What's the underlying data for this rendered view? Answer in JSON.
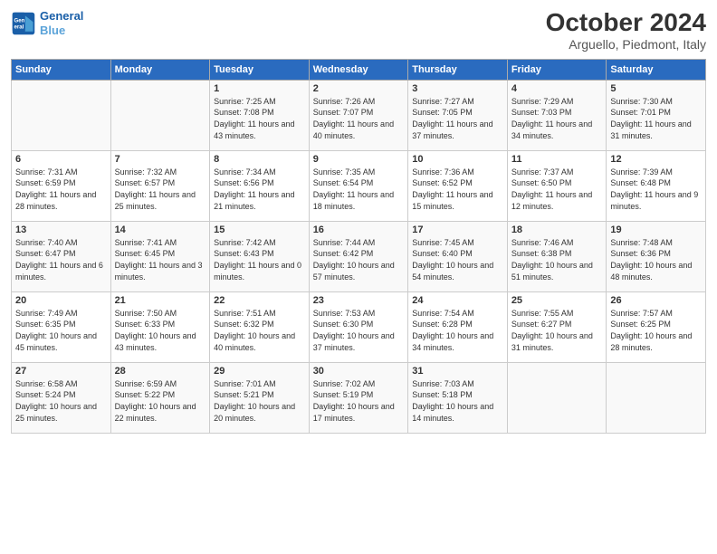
{
  "header": {
    "logo_line1": "General",
    "logo_line2": "Blue",
    "month": "October 2024",
    "location": "Arguello, Piedmont, Italy"
  },
  "days_of_week": [
    "Sunday",
    "Monday",
    "Tuesday",
    "Wednesday",
    "Thursday",
    "Friday",
    "Saturday"
  ],
  "weeks": [
    [
      {
        "day": "",
        "sunrise": "",
        "sunset": "",
        "daylight": ""
      },
      {
        "day": "",
        "sunrise": "",
        "sunset": "",
        "daylight": ""
      },
      {
        "day": "1",
        "sunrise": "Sunrise: 7:25 AM",
        "sunset": "Sunset: 7:08 PM",
        "daylight": "Daylight: 11 hours and 43 minutes."
      },
      {
        "day": "2",
        "sunrise": "Sunrise: 7:26 AM",
        "sunset": "Sunset: 7:07 PM",
        "daylight": "Daylight: 11 hours and 40 minutes."
      },
      {
        "day": "3",
        "sunrise": "Sunrise: 7:27 AM",
        "sunset": "Sunset: 7:05 PM",
        "daylight": "Daylight: 11 hours and 37 minutes."
      },
      {
        "day": "4",
        "sunrise": "Sunrise: 7:29 AM",
        "sunset": "Sunset: 7:03 PM",
        "daylight": "Daylight: 11 hours and 34 minutes."
      },
      {
        "day": "5",
        "sunrise": "Sunrise: 7:30 AM",
        "sunset": "Sunset: 7:01 PM",
        "daylight": "Daylight: 11 hours and 31 minutes."
      }
    ],
    [
      {
        "day": "6",
        "sunrise": "Sunrise: 7:31 AM",
        "sunset": "Sunset: 6:59 PM",
        "daylight": "Daylight: 11 hours and 28 minutes."
      },
      {
        "day": "7",
        "sunrise": "Sunrise: 7:32 AM",
        "sunset": "Sunset: 6:57 PM",
        "daylight": "Daylight: 11 hours and 25 minutes."
      },
      {
        "day": "8",
        "sunrise": "Sunrise: 7:34 AM",
        "sunset": "Sunset: 6:56 PM",
        "daylight": "Daylight: 11 hours and 21 minutes."
      },
      {
        "day": "9",
        "sunrise": "Sunrise: 7:35 AM",
        "sunset": "Sunset: 6:54 PM",
        "daylight": "Daylight: 11 hours and 18 minutes."
      },
      {
        "day": "10",
        "sunrise": "Sunrise: 7:36 AM",
        "sunset": "Sunset: 6:52 PM",
        "daylight": "Daylight: 11 hours and 15 minutes."
      },
      {
        "day": "11",
        "sunrise": "Sunrise: 7:37 AM",
        "sunset": "Sunset: 6:50 PM",
        "daylight": "Daylight: 11 hours and 12 minutes."
      },
      {
        "day": "12",
        "sunrise": "Sunrise: 7:39 AM",
        "sunset": "Sunset: 6:48 PM",
        "daylight": "Daylight: 11 hours and 9 minutes."
      }
    ],
    [
      {
        "day": "13",
        "sunrise": "Sunrise: 7:40 AM",
        "sunset": "Sunset: 6:47 PM",
        "daylight": "Daylight: 11 hours and 6 minutes."
      },
      {
        "day": "14",
        "sunrise": "Sunrise: 7:41 AM",
        "sunset": "Sunset: 6:45 PM",
        "daylight": "Daylight: 11 hours and 3 minutes."
      },
      {
        "day": "15",
        "sunrise": "Sunrise: 7:42 AM",
        "sunset": "Sunset: 6:43 PM",
        "daylight": "Daylight: 11 hours and 0 minutes."
      },
      {
        "day": "16",
        "sunrise": "Sunrise: 7:44 AM",
        "sunset": "Sunset: 6:42 PM",
        "daylight": "Daylight: 10 hours and 57 minutes."
      },
      {
        "day": "17",
        "sunrise": "Sunrise: 7:45 AM",
        "sunset": "Sunset: 6:40 PM",
        "daylight": "Daylight: 10 hours and 54 minutes."
      },
      {
        "day": "18",
        "sunrise": "Sunrise: 7:46 AM",
        "sunset": "Sunset: 6:38 PM",
        "daylight": "Daylight: 10 hours and 51 minutes."
      },
      {
        "day": "19",
        "sunrise": "Sunrise: 7:48 AM",
        "sunset": "Sunset: 6:36 PM",
        "daylight": "Daylight: 10 hours and 48 minutes."
      }
    ],
    [
      {
        "day": "20",
        "sunrise": "Sunrise: 7:49 AM",
        "sunset": "Sunset: 6:35 PM",
        "daylight": "Daylight: 10 hours and 45 minutes."
      },
      {
        "day": "21",
        "sunrise": "Sunrise: 7:50 AM",
        "sunset": "Sunset: 6:33 PM",
        "daylight": "Daylight: 10 hours and 43 minutes."
      },
      {
        "day": "22",
        "sunrise": "Sunrise: 7:51 AM",
        "sunset": "Sunset: 6:32 PM",
        "daylight": "Daylight: 10 hours and 40 minutes."
      },
      {
        "day": "23",
        "sunrise": "Sunrise: 7:53 AM",
        "sunset": "Sunset: 6:30 PM",
        "daylight": "Daylight: 10 hours and 37 minutes."
      },
      {
        "day": "24",
        "sunrise": "Sunrise: 7:54 AM",
        "sunset": "Sunset: 6:28 PM",
        "daylight": "Daylight: 10 hours and 34 minutes."
      },
      {
        "day": "25",
        "sunrise": "Sunrise: 7:55 AM",
        "sunset": "Sunset: 6:27 PM",
        "daylight": "Daylight: 10 hours and 31 minutes."
      },
      {
        "day": "26",
        "sunrise": "Sunrise: 7:57 AM",
        "sunset": "Sunset: 6:25 PM",
        "daylight": "Daylight: 10 hours and 28 minutes."
      }
    ],
    [
      {
        "day": "27",
        "sunrise": "Sunrise: 6:58 AM",
        "sunset": "Sunset: 5:24 PM",
        "daylight": "Daylight: 10 hours and 25 minutes."
      },
      {
        "day": "28",
        "sunrise": "Sunrise: 6:59 AM",
        "sunset": "Sunset: 5:22 PM",
        "daylight": "Daylight: 10 hours and 22 minutes."
      },
      {
        "day": "29",
        "sunrise": "Sunrise: 7:01 AM",
        "sunset": "Sunset: 5:21 PM",
        "daylight": "Daylight: 10 hours and 20 minutes."
      },
      {
        "day": "30",
        "sunrise": "Sunrise: 7:02 AM",
        "sunset": "Sunset: 5:19 PM",
        "daylight": "Daylight: 10 hours and 17 minutes."
      },
      {
        "day": "31",
        "sunrise": "Sunrise: 7:03 AM",
        "sunset": "Sunset: 5:18 PM",
        "daylight": "Daylight: 10 hours and 14 minutes."
      },
      {
        "day": "",
        "sunrise": "",
        "sunset": "",
        "daylight": ""
      },
      {
        "day": "",
        "sunrise": "",
        "sunset": "",
        "daylight": ""
      }
    ]
  ]
}
